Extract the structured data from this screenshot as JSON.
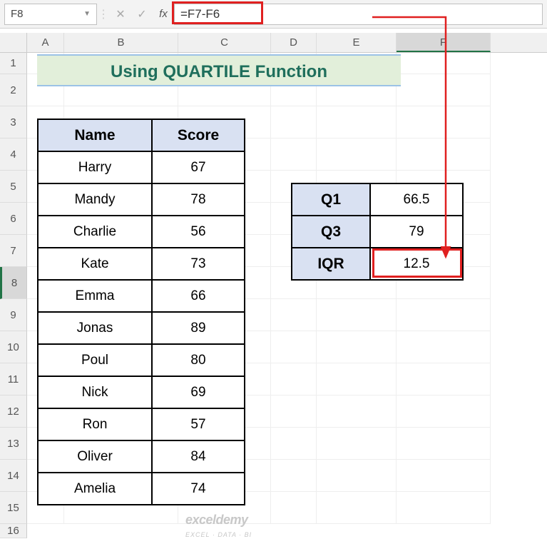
{
  "name_box": "F8",
  "formula": "=F7-F6",
  "title": "Using QUARTILE Function",
  "col_headers": {
    "A": "A",
    "B": "B",
    "C": "C",
    "D": "D",
    "E": "E",
    "F": "F"
  },
  "col_widths": {
    "A": 52,
    "B": 160,
    "C": 130,
    "D": 64,
    "E": 112,
    "F": 132
  },
  "row_labels": [
    "1",
    "2",
    "3",
    "4",
    "5",
    "6",
    "7",
    "8",
    "9",
    "10",
    "11",
    "12",
    "13",
    "14",
    "15",
    "16"
  ],
  "table": {
    "headers": {
      "name": "Name",
      "score": "Score"
    },
    "rows": [
      {
        "name": "Harry",
        "score": 67
      },
      {
        "name": "Mandy",
        "score": 78
      },
      {
        "name": "Charlie",
        "score": 56
      },
      {
        "name": "Kate",
        "score": 73
      },
      {
        "name": "Emma",
        "score": 66
      },
      {
        "name": "Jonas",
        "score": 89
      },
      {
        "name": "Poul",
        "score": 80
      },
      {
        "name": "Nick",
        "score": 69
      },
      {
        "name": "Ron",
        "score": 57
      },
      {
        "name": "Oliver",
        "score": 84
      },
      {
        "name": "Amelia",
        "score": 74
      }
    ]
  },
  "stats": {
    "rows": [
      {
        "label": "Q1",
        "value": 66.5
      },
      {
        "label": "Q3",
        "value": 79
      },
      {
        "label": "IQR",
        "value": 12.5
      }
    ]
  },
  "watermark": {
    "brand": "exceldemy",
    "tag": "EXCEL · DATA · BI"
  },
  "chart_data": {
    "type": "table",
    "title": "Using QUARTILE Function",
    "categories": [
      "Harry",
      "Mandy",
      "Charlie",
      "Kate",
      "Emma",
      "Jonas",
      "Poul",
      "Nick",
      "Ron",
      "Oliver",
      "Amelia"
    ],
    "values": [
      67,
      78,
      56,
      73,
      66,
      89,
      80,
      69,
      57,
      84,
      74
    ],
    "stats": {
      "Q1": 66.5,
      "Q3": 79,
      "IQR": 12.5
    },
    "formula_shown": "=F7-F6"
  }
}
